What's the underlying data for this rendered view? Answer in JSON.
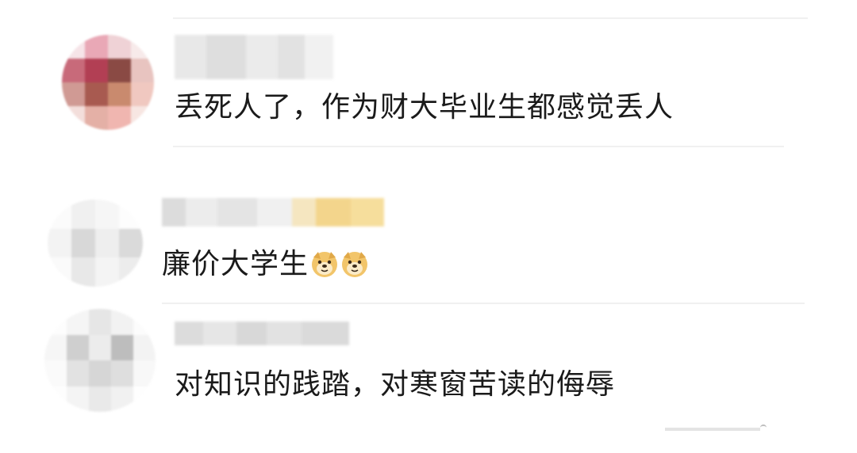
{
  "comments": [
    {
      "username": "",
      "text": "丢死人了，作为财大毕业生都感觉丢人",
      "emojis": []
    },
    {
      "username": "",
      "text": "廉价大学生",
      "emojis": [
        "doge-emoji",
        "doge-emoji"
      ]
    },
    {
      "username": "",
      "text": "对知识的践踏，对寒窗苦读的侮辱",
      "emojis": []
    }
  ],
  "colors": {
    "text": "#1a1a1a",
    "divider": "#f0f0f0",
    "blur_gray": "#e6e6e6",
    "blur_yellow": "#f7d98a"
  }
}
